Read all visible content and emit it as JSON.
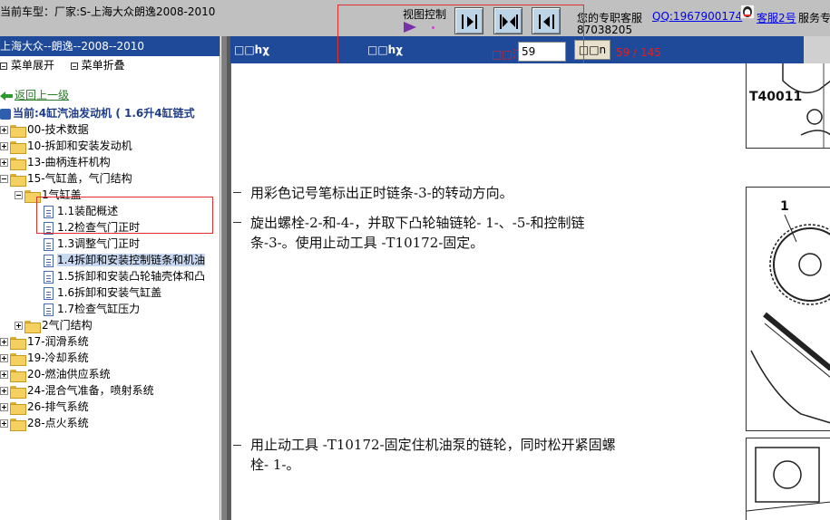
{
  "topbar": {
    "car_label": "当前车型：厂家:S-上海大众朗逸2008-2010",
    "view_control_label": "视图控制",
    "service_prefix": "您的专职客服",
    "qq_link": "QQ:1967900174",
    "kf_link": "客服2号",
    "kf_suffix": "服务专",
    "phone": "87038205",
    "buttons": [
      {
        "name": "align-left-button",
        "icon": "arrow-right-bar-icon"
      },
      {
        "name": "align-center-button",
        "icon": "arrows-center-icon"
      },
      {
        "name": "align-right-button",
        "icon": "arrow-left-bar-icon"
      }
    ]
  },
  "sidebar": {
    "header": "上海大众--朗逸--2008--2010",
    "expand_label": "菜单展开",
    "collapse_label": "菜单折叠",
    "back_label": "返回上一级",
    "current_label": "当前:4缸汽油发动机 ( 1.6升4缸链式",
    "tree": [
      {
        "label": "00-技术数据",
        "type": "folder",
        "state": "plus"
      },
      {
        "label": "10-拆卸和安装发动机",
        "type": "folder",
        "state": "plus"
      },
      {
        "label": "13-曲柄连杆机构",
        "type": "folder",
        "state": "plus"
      },
      {
        "label": "15-气缸盖，气门结构",
        "type": "folder",
        "state": "minus"
      },
      {
        "label": "1气缸盖",
        "type": "folder",
        "state": "minus"
      },
      {
        "label": "1.1装配概述",
        "type": "page"
      },
      {
        "label": "1.2检查气门正时",
        "type": "page"
      },
      {
        "label": "1.3调整气门正时",
        "type": "page"
      },
      {
        "label": "1.4拆卸和安装控制链条和机油",
        "type": "page",
        "selected": true
      },
      {
        "label": "1.5拆卸和安装凸轮轴壳体和凸",
        "type": "page"
      },
      {
        "label": "1.6拆卸和安装气缸盖",
        "type": "page"
      },
      {
        "label": "1.7检查气缸压力",
        "type": "page"
      },
      {
        "label": "2气门结构",
        "type": "folder",
        "state": "plus"
      },
      {
        "label": "17-润滑系统",
        "type": "folder",
        "state": "plus"
      },
      {
        "label": "19-冷却系统",
        "type": "folder",
        "state": "plus"
      },
      {
        "label": "20-燃油供应系统",
        "type": "folder",
        "state": "plus"
      },
      {
        "label": "24-混合气准备，喷射系统",
        "type": "folder",
        "state": "plus"
      },
      {
        "label": "26-排气系统",
        "type": "folder",
        "state": "plus"
      },
      {
        "label": "28-点火系统",
        "type": "folder",
        "state": "plus"
      }
    ]
  },
  "content": {
    "header_left": "□□hχ",
    "header_mid": "□□hχ",
    "page_label": "□□汀",
    "page_value": "59",
    "go_label": "□□n",
    "page_count": "59 / 145",
    "paragraphs": [
      "用彩色记号笔标出正时链条-3-的转动方向。",
      "旋出螺栓-2-和-4-，并取下凸轮轴链轮- 1-、-5-和控制链",
      "条-3-。使用止动工具 -T10172-固定。",
      "用止动工具 -T10172-固定住机油泵的链轮，同时松开紧固螺",
      "栓- 1-。"
    ],
    "figure_labels": [
      "T40011",
      "1"
    ]
  }
}
